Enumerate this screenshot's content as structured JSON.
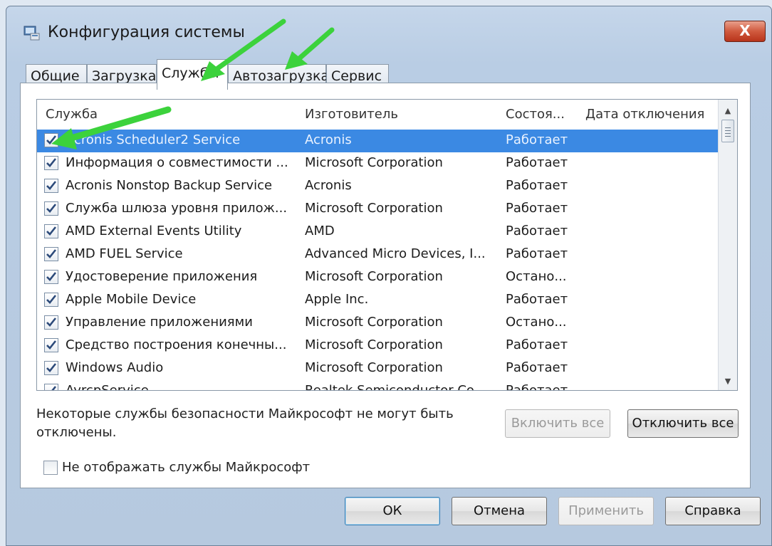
{
  "window": {
    "title": "Конфигурация системы",
    "close_label": "X"
  },
  "tabs": [
    {
      "label": "Общие"
    },
    {
      "label": "Загрузка"
    },
    {
      "label": "Службы"
    },
    {
      "label": "Автозагрузка"
    },
    {
      "label": "Сервис"
    }
  ],
  "active_tab": "Службы",
  "table": {
    "headers": [
      "Служба",
      "Изготовитель",
      "Состоя...",
      "Дата отключения"
    ],
    "rows": [
      {
        "service": "Acronis Scheduler2 Service",
        "vendor": "Acronis",
        "status": "Работает",
        "date": "",
        "checked": true,
        "selected": true
      },
      {
        "service": "Информация о совместимости ...",
        "vendor": "Microsoft Corporation",
        "status": "Работает",
        "date": "",
        "checked": true
      },
      {
        "service": "Acronis Nonstop Backup Service",
        "vendor": "Acronis",
        "status": "Работает",
        "date": "",
        "checked": true
      },
      {
        "service": "Служба шлюза уровня прилож...",
        "vendor": "Microsoft Corporation",
        "status": "Работает",
        "date": "",
        "checked": true
      },
      {
        "service": "AMD External Events Utility",
        "vendor": "AMD",
        "status": "Работает",
        "date": "",
        "checked": true
      },
      {
        "service": "AMD FUEL Service",
        "vendor": "Advanced Micro Devices, I...",
        "status": "Работает",
        "date": "",
        "checked": true
      },
      {
        "service": "Удостоверение приложения",
        "vendor": "Microsoft Corporation",
        "status": "Остано...",
        "date": "",
        "checked": true
      },
      {
        "service": "Apple Mobile Device",
        "vendor": "Apple Inc.",
        "status": "Работает",
        "date": "",
        "checked": true
      },
      {
        "service": "Управление приложениями",
        "vendor": "Microsoft Corporation",
        "status": "Остано...",
        "date": "",
        "checked": true
      },
      {
        "service": "Средство построения конечны...",
        "vendor": "Microsoft Corporation",
        "status": "Работает",
        "date": "",
        "checked": true
      },
      {
        "service": "Windows Audio",
        "vendor": "Microsoft Corporation",
        "status": "Работает",
        "date": "",
        "checked": true
      },
      {
        "service": "AvrcpService",
        "vendor": "Realtek Semiconductor Co...",
        "status": "Работает",
        "date": "",
        "checked": true
      }
    ]
  },
  "note": "Некоторые службы безопасности Майкрософт не могут быть отключены.",
  "buttons": {
    "enable_all": "Включить все",
    "disable_all": "Отключить все",
    "ok": "ОК",
    "cancel": "Отмена",
    "apply": "Применить",
    "help": "Справка"
  },
  "hide_ms": {
    "label": "Не отображать службы Майкрософт",
    "checked": false
  },
  "colors": {
    "selection": "#3b89e3",
    "accent_arrow": "#3cd23c",
    "close_button": "#d05a3e"
  }
}
